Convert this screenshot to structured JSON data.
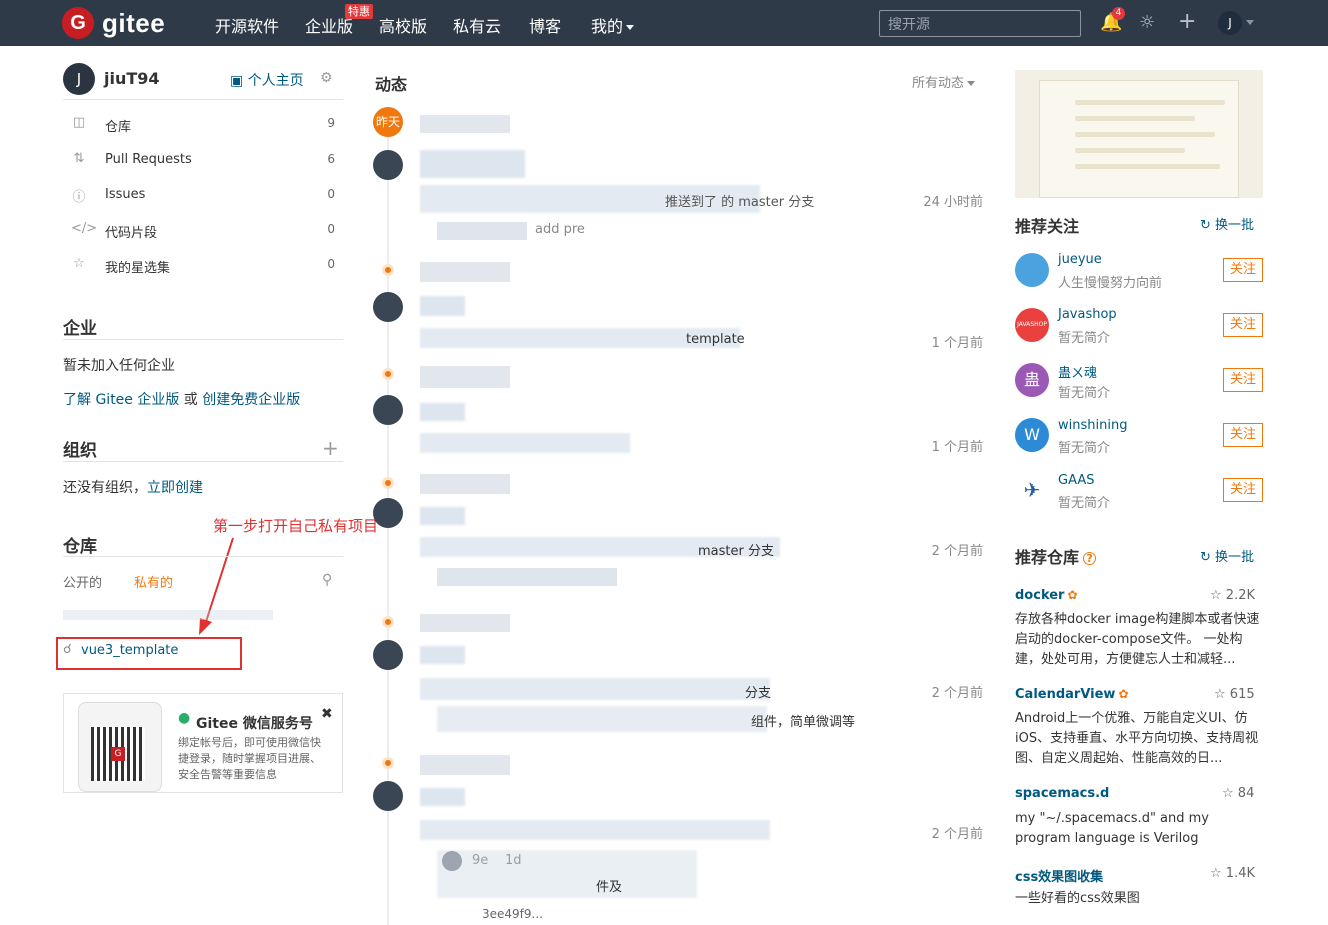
{
  "topnav": {
    "logo_text": "gitee",
    "logo_letter": "G",
    "items": [
      "开源软件",
      "企业版",
      "高校版",
      "私有云",
      "博客",
      "我的"
    ],
    "hot_badge": "特惠",
    "search_placeholder": "搜开源",
    "notification_count": "4",
    "avatar_letter": "J"
  },
  "user": {
    "avatar_letter": "J",
    "name": "jiuT94",
    "home_link": "个人主页"
  },
  "menu": [
    {
      "label": "仓库",
      "count": "9",
      "icon": "repo-icon"
    },
    {
      "label": "Pull Requests",
      "count": "6",
      "icon": "pull-request-icon"
    },
    {
      "label": "Issues",
      "count": "0",
      "icon": "issue-icon"
    },
    {
      "label": "代码片段",
      "count": "0",
      "icon": "code-icon"
    },
    {
      "label": "我的星选集",
      "count": "0",
      "icon": "star-icon"
    }
  ],
  "enterprise": {
    "title": "企业",
    "empty_text": "暂未加入任何企业",
    "learn_link": "了解 Gitee 企业版",
    "or_text": " 或 ",
    "create_link": "创建免费企业版"
  },
  "organization": {
    "title": "组织",
    "empty_text": "还没有组织，",
    "create_link": "立即创建"
  },
  "repos": {
    "title": "仓库",
    "tab_public": "公开的",
    "tab_private": "私有的",
    "private_repo": "vue3_template",
    "annotation": "第一步打开自己私有项目"
  },
  "wechat_card": {
    "title": "Gitee 微信服务号",
    "desc": "绑定帐号后，即可使用微信快捷登录，随时掌握项目进展、安全告警等重要信息"
  },
  "feed": {
    "title": "动态",
    "filter": "所有动态",
    "day_badge": "昨天",
    "items": [
      {
        "time": "24 小时前",
        "fragment": "推送到了 的 master 分支"
      },
      {
        "time": "1 个月前",
        "fragment": "template"
      },
      {
        "time": "1 个月前",
        "fragment": ""
      },
      {
        "time": "2 个月前",
        "fragment": "master 分支"
      },
      {
        "time": "2 个月前",
        "fragment": "分支"
      },
      {
        "time": "2 个月前",
        "fragment": ""
      }
    ],
    "extra_fragments": {
      "a": "add pre",
      "b": "组件，简单微调等",
      "c": "9e",
      "d": "1d",
      "e": "件及",
      "f": "3ee49f9..."
    }
  },
  "recommend_users": {
    "title": "推荐关注",
    "refresh": "换一批",
    "follow_label": "关注",
    "users": [
      {
        "name": "jueyue",
        "desc": "人生慢慢努力向前",
        "avatar_color": "#4aa3df",
        "avatar_text": ""
      },
      {
        "name": "Javashop",
        "desc": "暂无简介",
        "avatar_color": "#e8413e",
        "avatar_text": "JAVASHOP"
      },
      {
        "name": "蛊ㄨ魂",
        "desc": "暂无简介",
        "avatar_color": "#9b59b6",
        "avatar_text": "蛊"
      },
      {
        "name": "winshining",
        "desc": "暂无简介",
        "avatar_color": "#2c8ad6",
        "avatar_text": "W"
      },
      {
        "name": "GAAS",
        "desc": "暂无简介",
        "avatar_color": "#ffffff",
        "avatar_text": "✈"
      }
    ]
  },
  "recommend_repos": {
    "title": "推荐仓库",
    "refresh": "换一批",
    "repos": [
      {
        "name": "docker",
        "stars": "2.2K",
        "desc": "存放各种docker image构建脚本或者快速启动的docker-compose文件。 一处构建，处处可用，方便健忘人士和减轻..."
      },
      {
        "name": "CalendarView",
        "stars": "615",
        "desc": "Android上一个优雅、万能自定义UI、仿iOS、支持垂直、水平方向切换、支持周视图、自定义周起始、性能高效的日..."
      },
      {
        "name": "spacemacs.d",
        "stars": "84",
        "desc": "my \"~/.spacemacs.d\" and my program language is Verilog"
      },
      {
        "name": "css效果图收集",
        "stars": "1.4K",
        "desc": "一些好看的css效果图"
      }
    ]
  }
}
